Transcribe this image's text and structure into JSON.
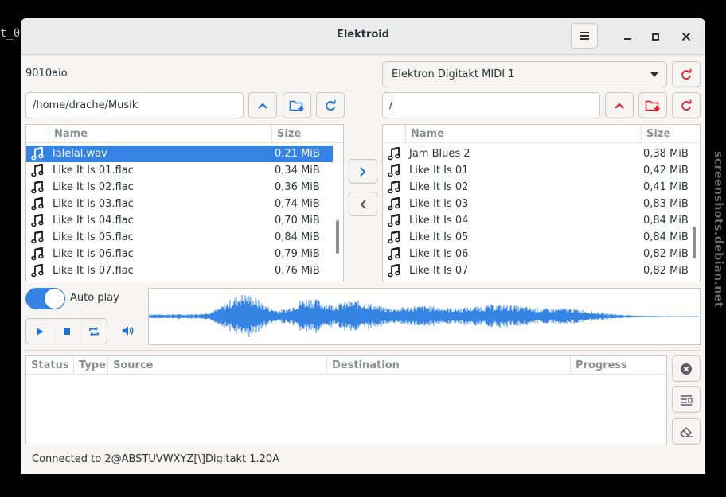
{
  "background_terminal_text": "t_0",
  "watermark": "screenshots.debian.net",
  "window": {
    "title": "Elektroid",
    "accent_color": "#3584e4",
    "danger_color": "#e01b24"
  },
  "local": {
    "host_label": "9010aio",
    "path": "/home/drache/Musik",
    "columns": {
      "name": "Name",
      "size": "Size"
    },
    "files": [
      {
        "name": "lalelal.wav",
        "size": "0,21 MiB",
        "selected": true
      },
      {
        "name": "Like It Is 01.flac",
        "size": "0,34 MiB"
      },
      {
        "name": "Like It Is 02.flac",
        "size": "0,36 MiB"
      },
      {
        "name": "Like It Is 03.flac",
        "size": "0,74 MiB"
      },
      {
        "name": "Like It Is 04.flac",
        "size": "0,70 MiB"
      },
      {
        "name": "Like It Is 05.flac",
        "size": "0,84 MiB"
      },
      {
        "name": "Like It Is 06.flac",
        "size": "0,79 MiB"
      },
      {
        "name": "Like It Is 07.flac",
        "size": "0,76 MiB"
      }
    ]
  },
  "remote": {
    "device": "Elektron Digitakt MIDI 1",
    "path": "/",
    "columns": {
      "name": "Name",
      "size": "Size"
    },
    "files": [
      {
        "name": "Jam Blues 2",
        "size": "0,38 MiB"
      },
      {
        "name": "Like It Is 01",
        "size": "0,42 MiB"
      },
      {
        "name": "Like It Is 02",
        "size": "0,41 MiB"
      },
      {
        "name": "Like It Is 03",
        "size": "0,83 MiB"
      },
      {
        "name": "Like It Is 04",
        "size": "0,84 MiB"
      },
      {
        "name": "Like It Is 05",
        "size": "0,84 MiB"
      },
      {
        "name": "Like It Is 06",
        "size": "0,82 MiB"
      },
      {
        "name": "Like It Is 07",
        "size": "0,82 MiB"
      }
    ]
  },
  "player": {
    "autoplay_label": "Auto play",
    "autoplay_on": true
  },
  "tasks": {
    "columns": {
      "status": "Status",
      "type": "Type",
      "source": "Source",
      "destination": "Destination",
      "progress": "Progress"
    }
  },
  "statusbar": {
    "text": "Connected to 2@ABSTUVWXYZ[\\]Digitakt 1.20A"
  }
}
